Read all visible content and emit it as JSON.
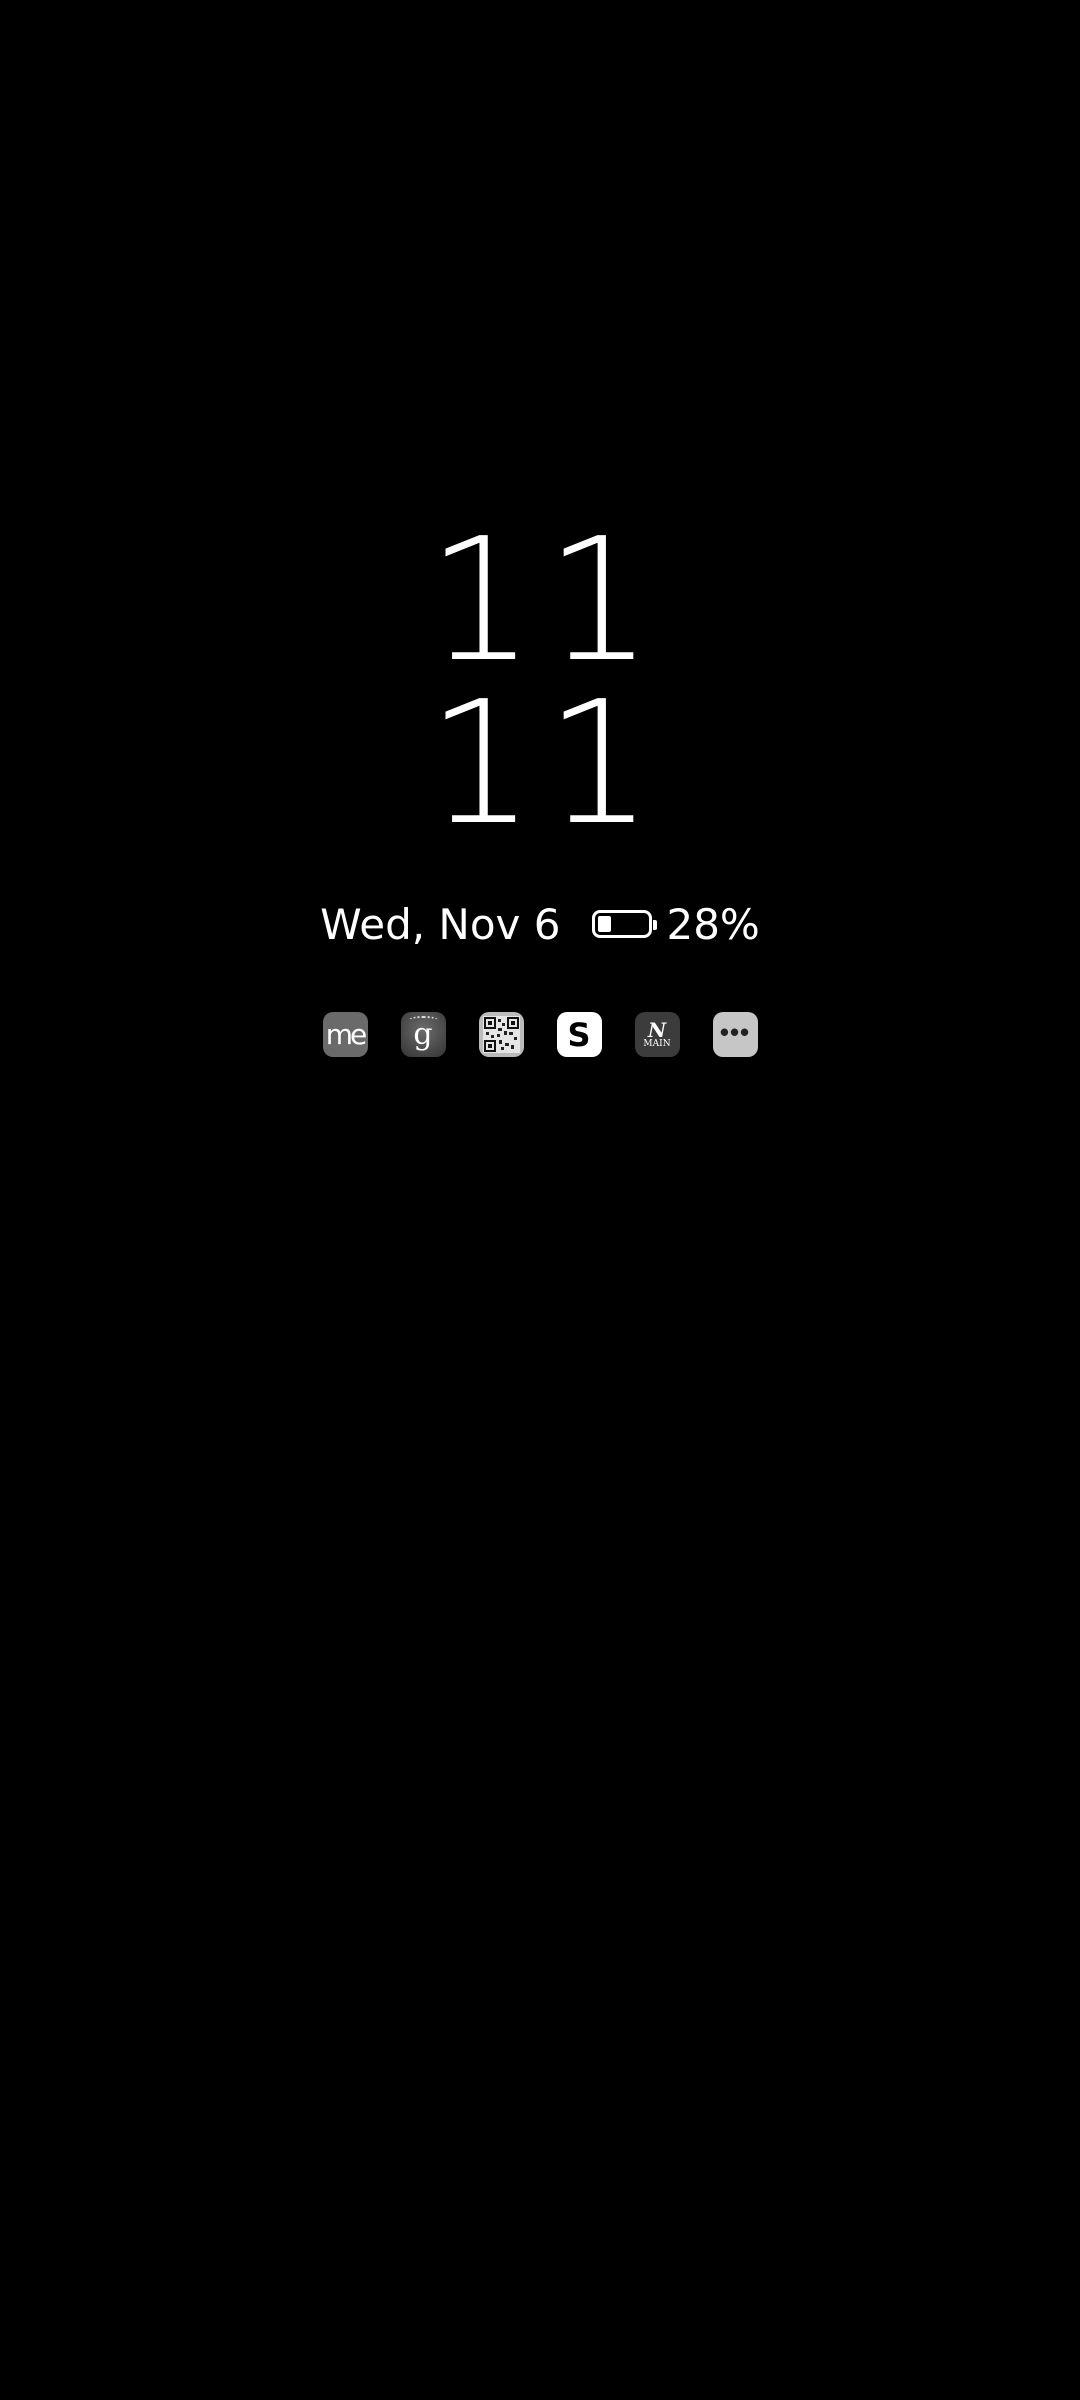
{
  "clock": {
    "hours": "11",
    "minutes": "11"
  },
  "status": {
    "date": "Wed, Nov 6",
    "battery_percent_text": "28%",
    "battery_level": 0.28
  },
  "apps": [
    {
      "name": "me-app-icon",
      "label": "me"
    },
    {
      "name": "g-app-icon",
      "label": "g"
    },
    {
      "name": "qr-app-icon",
      "label": ""
    },
    {
      "name": "s-app-icon",
      "label": "S"
    },
    {
      "name": "main-app-icon",
      "label": "N",
      "sublabel": "MAIN"
    },
    {
      "name": "more-apps-icon",
      "label": "•••"
    }
  ],
  "colors": {
    "background": "#000000",
    "foreground": "#ffffff"
  }
}
